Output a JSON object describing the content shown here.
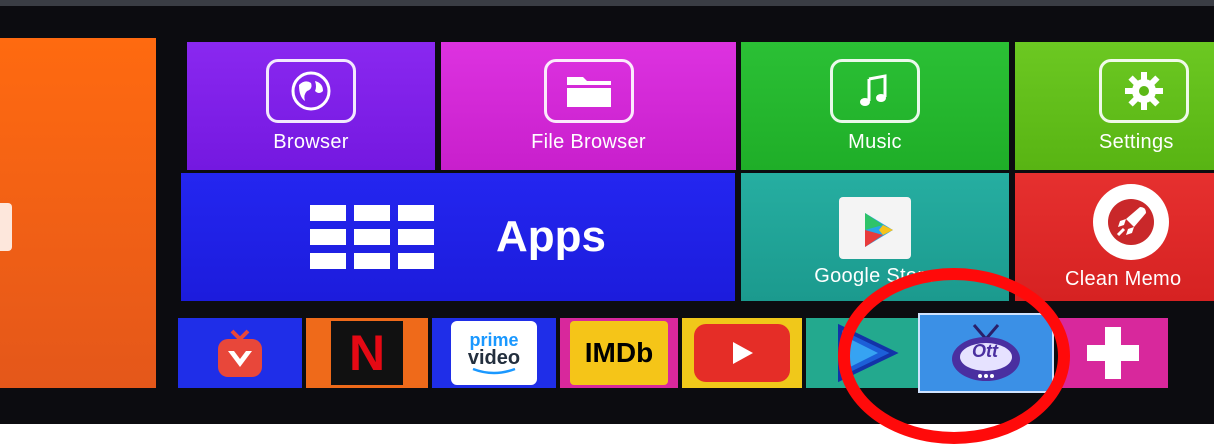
{
  "tiles": {
    "browser": {
      "label": "Browser",
      "color": "#7f1fe8"
    },
    "file_browser": {
      "label": "File Browser",
      "color": "#d42ad8"
    },
    "music": {
      "label": "Music",
      "color": "#22b82c"
    },
    "settings": {
      "label": "Settings",
      "color": "#63c01a"
    },
    "apps": {
      "label": "Apps",
      "color": "#1f1ee8"
    },
    "google_store": {
      "label": "Google Store",
      "color": "#1fa69a"
    },
    "clean_memory": {
      "label": "Clean Memo",
      "color": "#e2282a"
    }
  },
  "dock": {
    "items": [
      {
        "name": "app-red-tv",
        "color": "#1f2ee8"
      },
      {
        "name": "netflix",
        "label": "N",
        "color": "#ef6a1a"
      },
      {
        "name": "prime-video",
        "label_top": "prime",
        "label_bottom": "video",
        "color": "#1f2ee8"
      },
      {
        "name": "imdb",
        "label": "IMDb",
        "color": "#d8289c"
      },
      {
        "name": "youtube",
        "color": "#f0c81a"
      },
      {
        "name": "play-app",
        "color": "#23a98e"
      },
      {
        "name": "tv-app",
        "label": "Ott",
        "color": "#3b90e6"
      },
      {
        "name": "add",
        "color": "#d8289c"
      }
    ]
  },
  "annotation": {
    "color": "#ff0a0a"
  }
}
